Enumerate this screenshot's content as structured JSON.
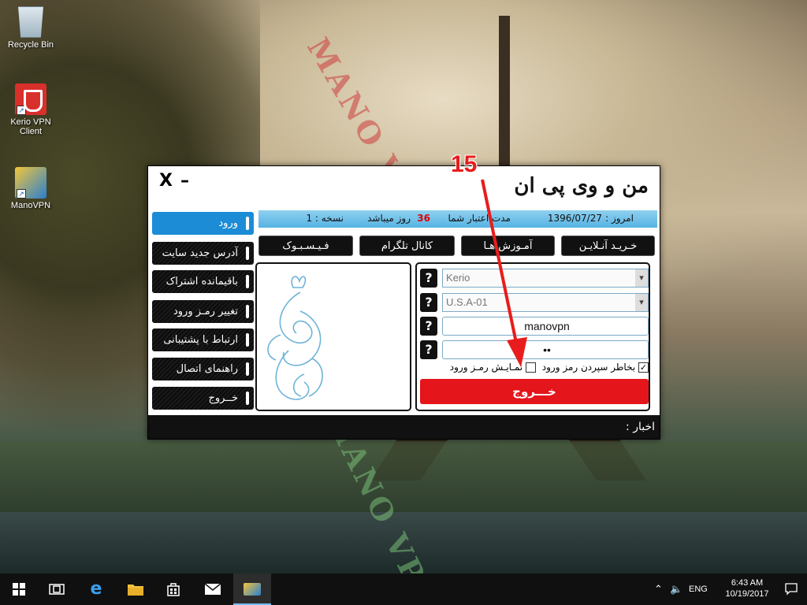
{
  "desktop": {
    "icons": [
      {
        "label": "Recycle Bin",
        "icon": "recycle-bin-icon"
      },
      {
        "label": "Kerio VPN Client",
        "icon": "kerio-vpn-icon"
      },
      {
        "label": "ManoVPN",
        "icon": "manovpn-icon"
      }
    ],
    "watermark": "MANO VPN"
  },
  "app": {
    "logo": "من و وی پی ان",
    "controls": {
      "close": "X",
      "minimize": "–"
    },
    "info": {
      "today_label": "امروز :",
      "today_date": "1396/07/27",
      "validity_label": "مدت اعتبار شما",
      "validity_days": "36",
      "days_suffix": "روز میباشد",
      "version": "نسخه : 1"
    },
    "top_buttons": {
      "buy": "خـریـد آنـلایـن",
      "tutorials": "آمـوزش هـا",
      "telegram": "کانال تلگرام",
      "facebook": "فـیـسـبـوک"
    },
    "sidebar": [
      {
        "label": "ورود"
      },
      {
        "label": "آدرس جدید سایت"
      },
      {
        "label": "باقیمانده اشتراک"
      },
      {
        "label": "تغییر رمـز ورود"
      },
      {
        "label": "ارتباط با پشتیبانی"
      },
      {
        "label": "راهنمای اتصال"
      },
      {
        "label": "خــروج"
      }
    ],
    "form": {
      "help": "?",
      "protocol": "Kerio",
      "server": "U.S.A-01",
      "username": "manovpn",
      "password": "••",
      "remember": "بخاطر سپردن رمز ورود",
      "show_password": "نمـایـش رمـز ورود",
      "exit_button": "خـــروج"
    },
    "news_label": "اخبار :"
  },
  "annotation": {
    "step": "15"
  },
  "taskbar": {
    "lang": "ENG",
    "time": "6:43 AM",
    "date": "10/19/2017"
  },
  "colors": {
    "accent_blue": "#1c8cd6",
    "exit_red": "#e4151b",
    "info_bar": "#56b3e3",
    "annotation_red": "#e81c1c"
  }
}
